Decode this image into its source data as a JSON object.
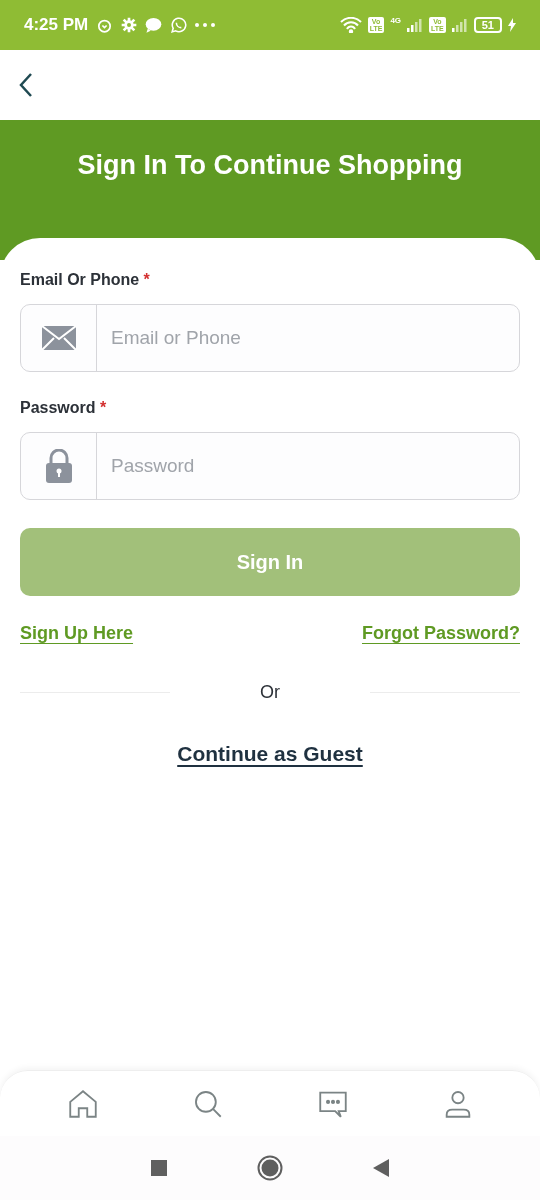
{
  "status_bar": {
    "time": "4:25 PM",
    "network": "4G",
    "volte": [
      [
        "Vo",
        "LTE"
      ],
      [
        "Vo",
        "LTE"
      ]
    ],
    "battery": "51"
  },
  "header": {
    "title": "Sign In To Continue Shopping"
  },
  "form": {
    "fields": [
      {
        "kind": "email",
        "label": "Email Or Phone",
        "required": true,
        "placeholder": "Email or Phone"
      },
      {
        "kind": "password",
        "label": "Password",
        "required": true,
        "placeholder": "Password"
      }
    ],
    "required_mark": "*",
    "submit": {
      "label": "Sign In",
      "disabled": true
    },
    "sign_up_link": "Sign Up Here",
    "forgot_link": "Forgot Password?",
    "divider": "Or",
    "guest_link": "Continue as Guest"
  },
  "bottom_nav": [
    {
      "kind": "home"
    },
    {
      "kind": "search"
    },
    {
      "kind": "chat"
    },
    {
      "kind": "profile"
    }
  ]
}
